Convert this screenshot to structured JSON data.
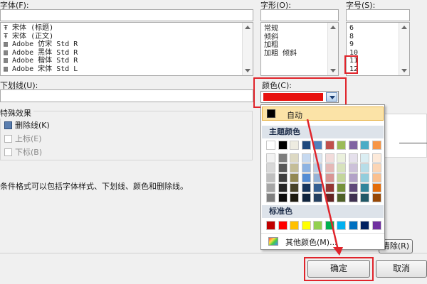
{
  "font": {
    "label": "字体(F):",
    "list": [
      "宋体 (标题)",
      "宋体 (正文)",
      "Adobe 仿宋 Std R",
      "Adobe 黑体 Std R",
      "Adobe 楷体 Std R",
      "Adobe 宋体 Std L"
    ]
  },
  "style": {
    "label": "字形(O):",
    "list": [
      "常规",
      "倾斜",
      "加粗",
      "加粗 倾斜"
    ]
  },
  "size": {
    "label": "字号(S):",
    "list": [
      "6",
      "8",
      "9",
      "10",
      "11",
      "12"
    ]
  },
  "underline": {
    "label": "下划线(U):"
  },
  "color": {
    "label": "颜色(C):",
    "selected_hex": "#e8120f"
  },
  "effects": {
    "title": "特殊效果",
    "strikethrough": {
      "label": "删除线(K)",
      "checked": true
    },
    "superscript": {
      "label": "上标(E)",
      "checked": false
    },
    "subscript": {
      "label": "下标(B)",
      "checked": false
    }
  },
  "note": "条件格式可以包括字体样式、下划线、颜色和删除线。",
  "palette": {
    "auto_label": "自动",
    "theme_title": "主题颜色",
    "theme_top": [
      "#ffffff",
      "#000000",
      "#eeece1",
      "#1f497d",
      "#4f81bd",
      "#c0504d",
      "#9bbb59",
      "#8064a2",
      "#4bacc6",
      "#f79646"
    ],
    "theme_shades": [
      [
        "#f2f2f2",
        "#7f7f7f",
        "#ddd9c3",
        "#c6d9f0",
        "#dbe5f1",
        "#f2dcdb",
        "#ebf1dd",
        "#e5e0ec",
        "#dbeef3",
        "#fdeada"
      ],
      [
        "#d8d8d8",
        "#595959",
        "#c4bd97",
        "#8db3e2",
        "#b8cce4",
        "#e5b9b7",
        "#d7e3bc",
        "#ccc1d9",
        "#b7dde8",
        "#fbd5b5"
      ],
      [
        "#bfbfbf",
        "#3f3f3f",
        "#938953",
        "#548dd4",
        "#95b3d7",
        "#d99694",
        "#c3d69b",
        "#b2a2c7",
        "#92cddc",
        "#fac08f"
      ],
      [
        "#a5a5a5",
        "#262626",
        "#494429",
        "#17365d",
        "#366092",
        "#953734",
        "#76923c",
        "#5f497a",
        "#31859b",
        "#e36c09"
      ],
      [
        "#7f7f7f",
        "#0c0c0c",
        "#1d1b10",
        "#0f243e",
        "#244061",
        "#632423",
        "#4f6128",
        "#3f3151",
        "#205867",
        "#974806"
      ]
    ],
    "standard_title": "标准色",
    "standard": [
      "#c00000",
      "#ff0000",
      "#ffc000",
      "#ffff00",
      "#92d050",
      "#00b050",
      "#00b0f0",
      "#0070c0",
      "#002060",
      "#7030a0"
    ],
    "more_label": "其他颜色(M)..."
  },
  "buttons": {
    "clear": "清除(R)",
    "ok": "确定",
    "cancel": "取消"
  }
}
